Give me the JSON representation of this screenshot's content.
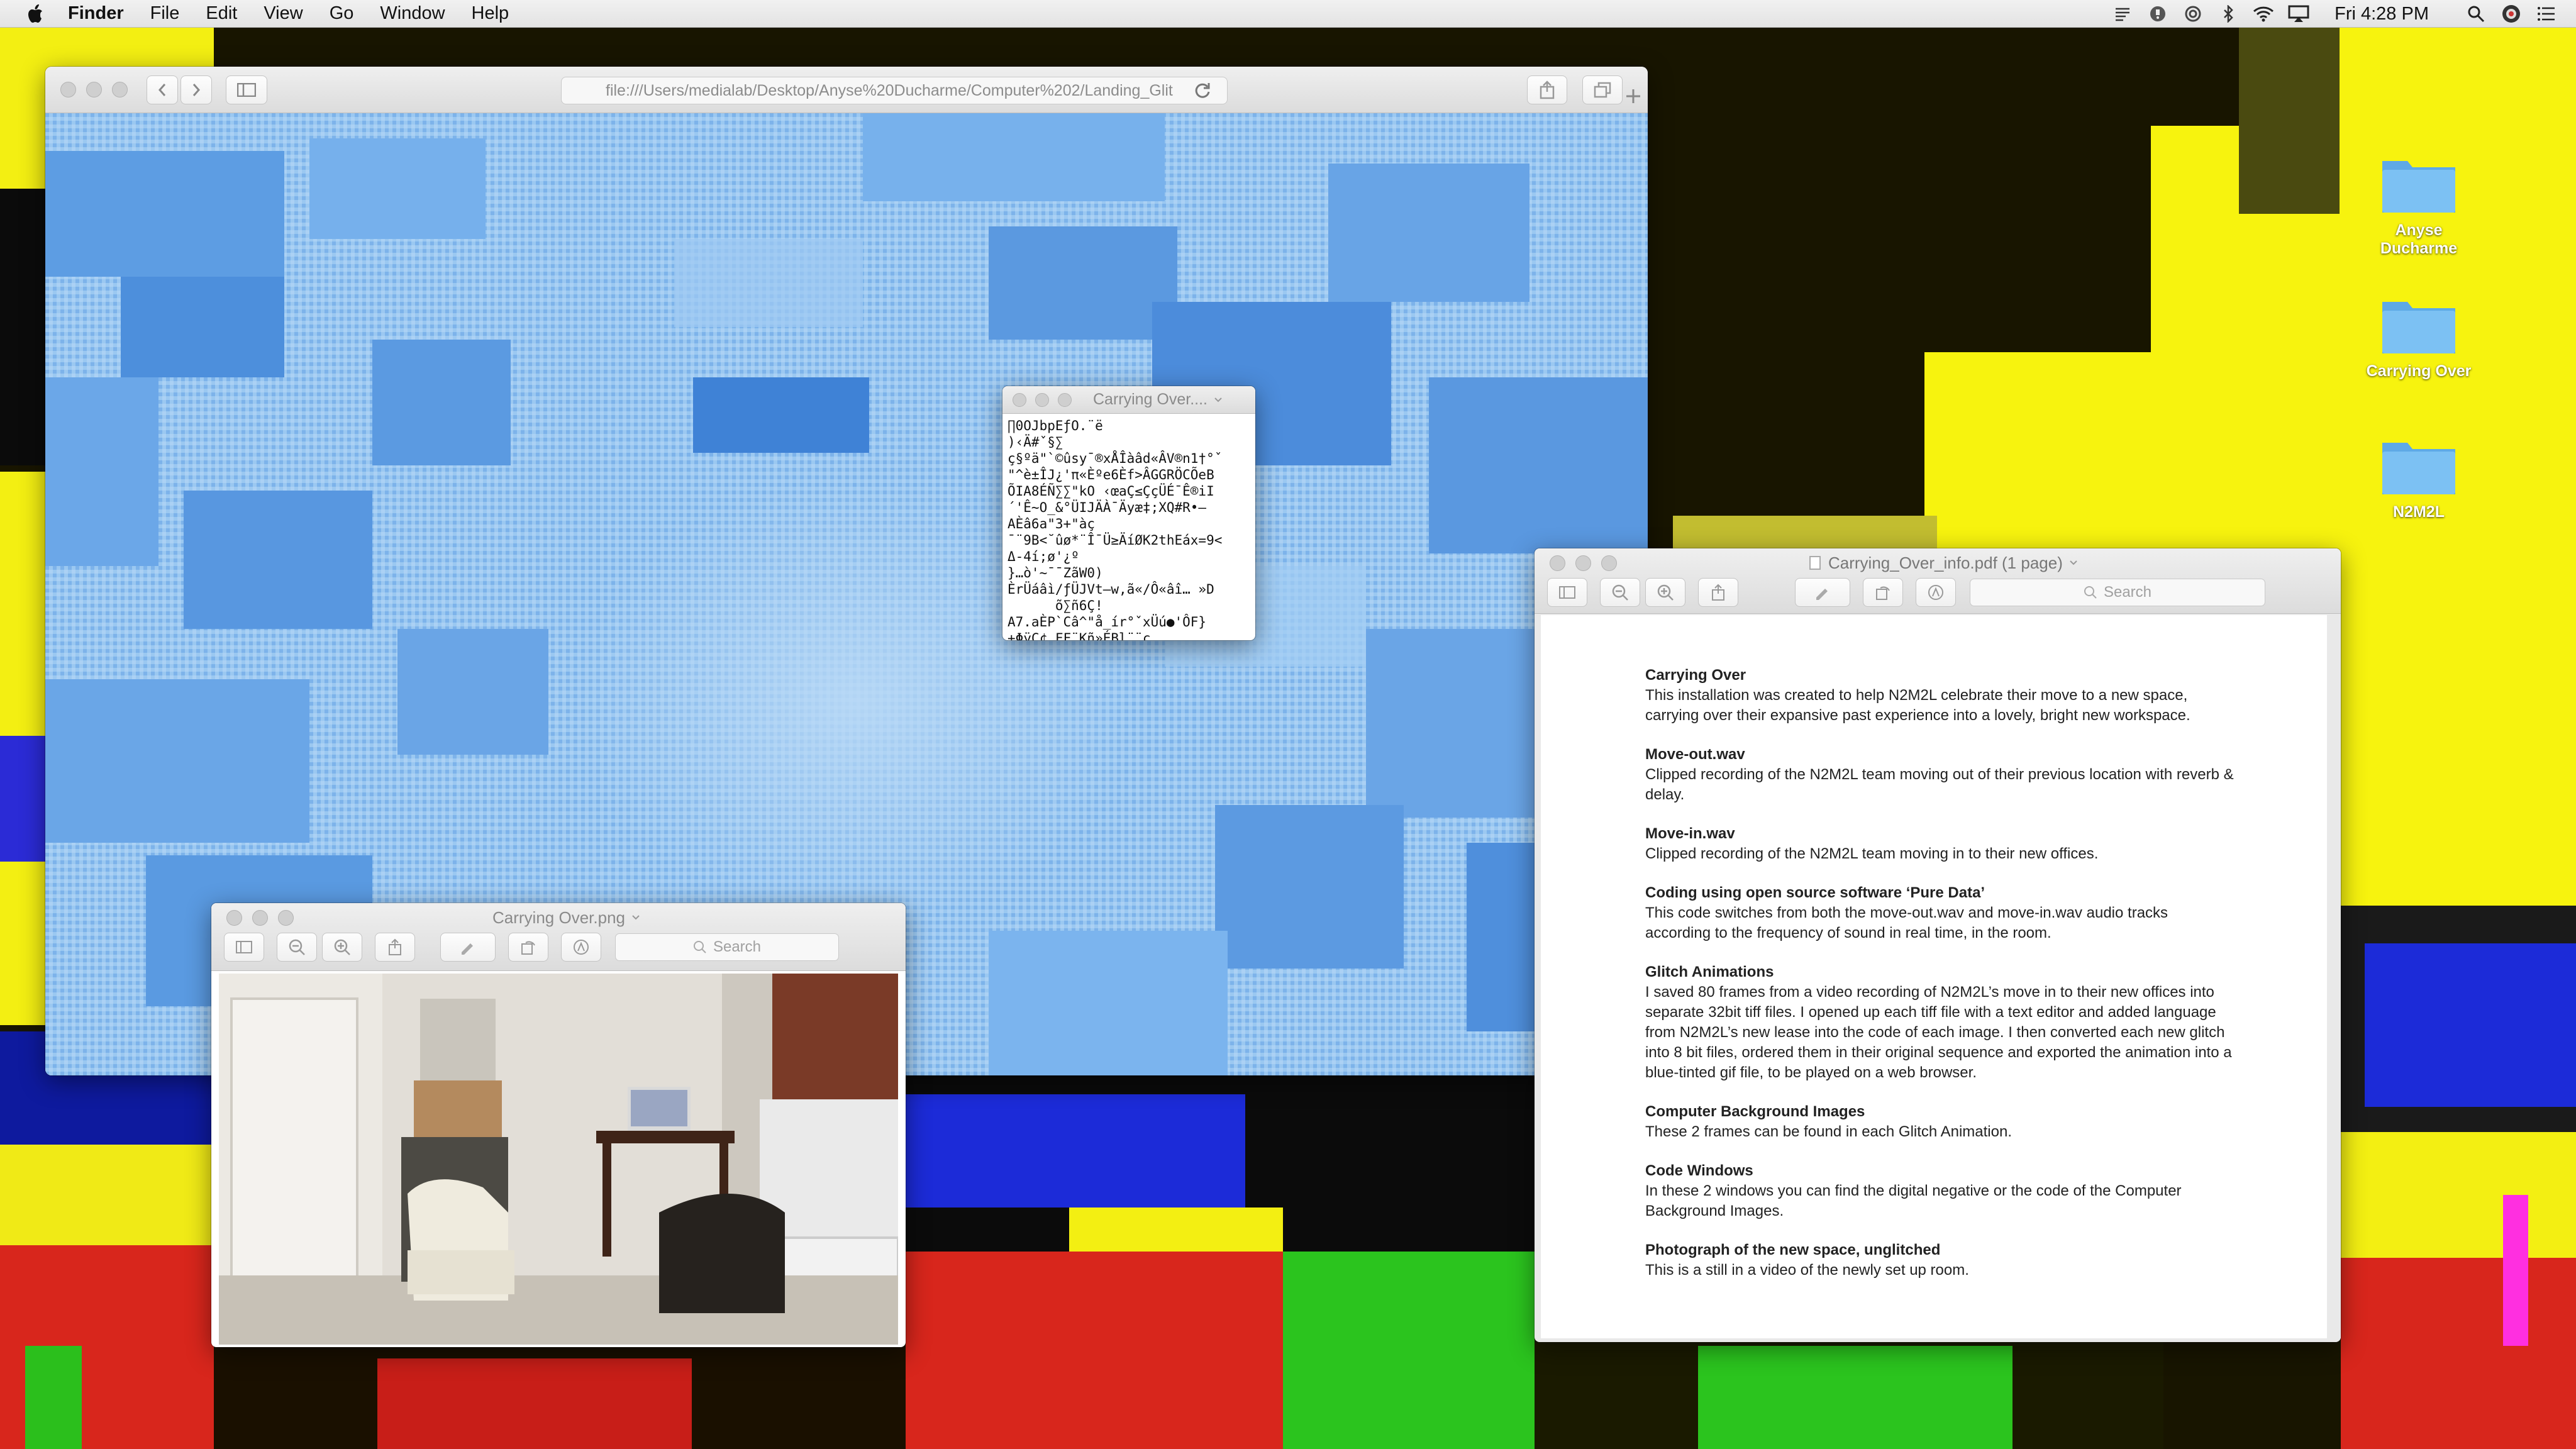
{
  "menubar": {
    "app": "Finder",
    "items": [
      "File",
      "Edit",
      "View",
      "Go",
      "Window",
      "Help"
    ],
    "clock": "Fri 4:28 PM"
  },
  "desktop_icons": [
    {
      "label": "Anyse Ducharme"
    },
    {
      "label": "Carrying Over"
    },
    {
      "label": "N2M2L"
    }
  ],
  "safari": {
    "url": "file:///Users/medialab/Desktop/Anyse%20Ducharme/Computer%202/Landing_Glit"
  },
  "textwin": {
    "title": "Carrying Over....",
    "content": "∏0OJbpEƒO.¨ë\n)‹Ä#ˇ§∑\nç§ºä\"`©ûsy¯®xÅÎàâd«ÂV®n1†°ˇ\n\"^è±ÎJ¿'π«Èºe6Èf>ÂGGRÖCÕeB\nÕIA8ÉÑ∑∑\"kO ‹œaÇ≤ÇçÜÉ¯Ê®iI\n´'Ê~O_&°ÜIJÄÀ¯Äyæ‡;XQ#R•–\nAÈâ6a\"3+\"àç\n¯¨9B<˘ûø*¨Î¯Ü≥ÄíØK2thEáx=9<\nΔ-4í;ø'¿º\n}…ò'~¯¯ZãW0)\nÈrÜáâì/ƒÜJVt—w,ã«/Ô«âî… »D\n      õ∑ñ6Ç!\nA7.aÈP`Câ^\"å_ír°ˇxÜú●'ÔF}\n+ΦÿÇ¢_FF¨Kñ»ÉBl¨¨c"
  },
  "pngwin": {
    "title": "Carrying Over.png",
    "search_placeholder": "Search"
  },
  "pdfwin": {
    "title": "Carrying_Over_info.pdf (1 page)",
    "search_placeholder": "Search",
    "sections": [
      {
        "heading": "Carrying Over",
        "body": "This installation was created to help N2M2L celebrate their move to a new space, carrying over their expansive past experience into a lovely, bright new workspace."
      },
      {
        "heading": "Move-out.wav",
        "body": "Clipped recording of the N2M2L team moving out of their previous location with reverb & delay."
      },
      {
        "heading": "Move-in.wav",
        "body": "Clipped recording of the N2M2L team moving in to their new offices."
      },
      {
        "heading": "Coding using open source software ‘Pure Data’",
        "body": "This code switches from both the move-out.wav and move-in.wav audio tracks according to the frequency of sound in real time, in the room."
      },
      {
        "heading": "Glitch Animations",
        "body": "I saved 80 frames from a video recording of N2M2L’s move in to their new offices into separate 32bit tiff files.  I opened up each tiff file with a text editor and added language from N2M2L’s new lease into the code of each image.  I then converted each new glitch into 8 bit files, ordered them in their original sequence and exported the animation into a blue-tinted gif file, to be played on a web browser."
      },
      {
        "heading": "Computer Background Images",
        "body": "These 2 frames can be found in each Glitch Animation."
      },
      {
        "heading": "Code Windows",
        "body": "In these 2 windows you can find the digital negative or the code of the Computer Background Images."
      },
      {
        "heading": "Photograph of the new space, unglitched",
        "body": "This is a still in a video of the newly set up room."
      }
    ]
  },
  "colors": {
    "glitch_yellow": "#f5f20f",
    "glitch_blue": "#0a2ad6",
    "glitch_red": "#e4241a",
    "glitch_green": "#27c21a",
    "folder_blue": "#6bb8ee",
    "safari_blue": "#8fc2f0"
  }
}
